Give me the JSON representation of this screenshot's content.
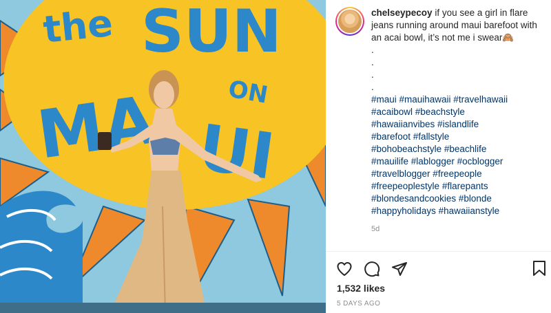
{
  "post": {
    "username": "chelseypecoy",
    "caption_text": " if you see a girl in flare jeans running around maui barefoot with an acai bowl, it’s not me i swear🙈",
    "caption_dots": [
      ".",
      ".",
      ".",
      "."
    ],
    "hashtag_lines": [
      "#maui #mauihawaii #travelhawaii",
      "#acaibowl #beachstyle",
      "#hawaiianvibes #islandlife",
      "#barefoot #fallstyle",
      "#bohobeachstyle #beachlife",
      "#mauilife #lablogger #ocblogger",
      "#travelblogger #freepeople",
      "#freepeoplestyle #flarepants",
      "#blondesandcookies #blonde",
      "#happyholidays #hawaiianstyle"
    ],
    "caption_age": "5d",
    "likes": "1,532 likes",
    "timestamp": "5 DAYS AGO"
  },
  "photo": {
    "mural_text": "the SUN on MAUI",
    "mural_words": [
      "the",
      "SUN",
      "ON",
      "MAUI"
    ]
  },
  "icons": {
    "like": "heart-icon",
    "comment": "comment-bubble-icon",
    "share": "paper-plane-icon",
    "save": "bookmark-icon"
  },
  "colors": {
    "hashtag": "#003569",
    "text": "#262626",
    "muted": "#8e8e8e",
    "sun": "#f7c325",
    "rays": "#ef8a2c",
    "letters": "#2c88c9"
  }
}
